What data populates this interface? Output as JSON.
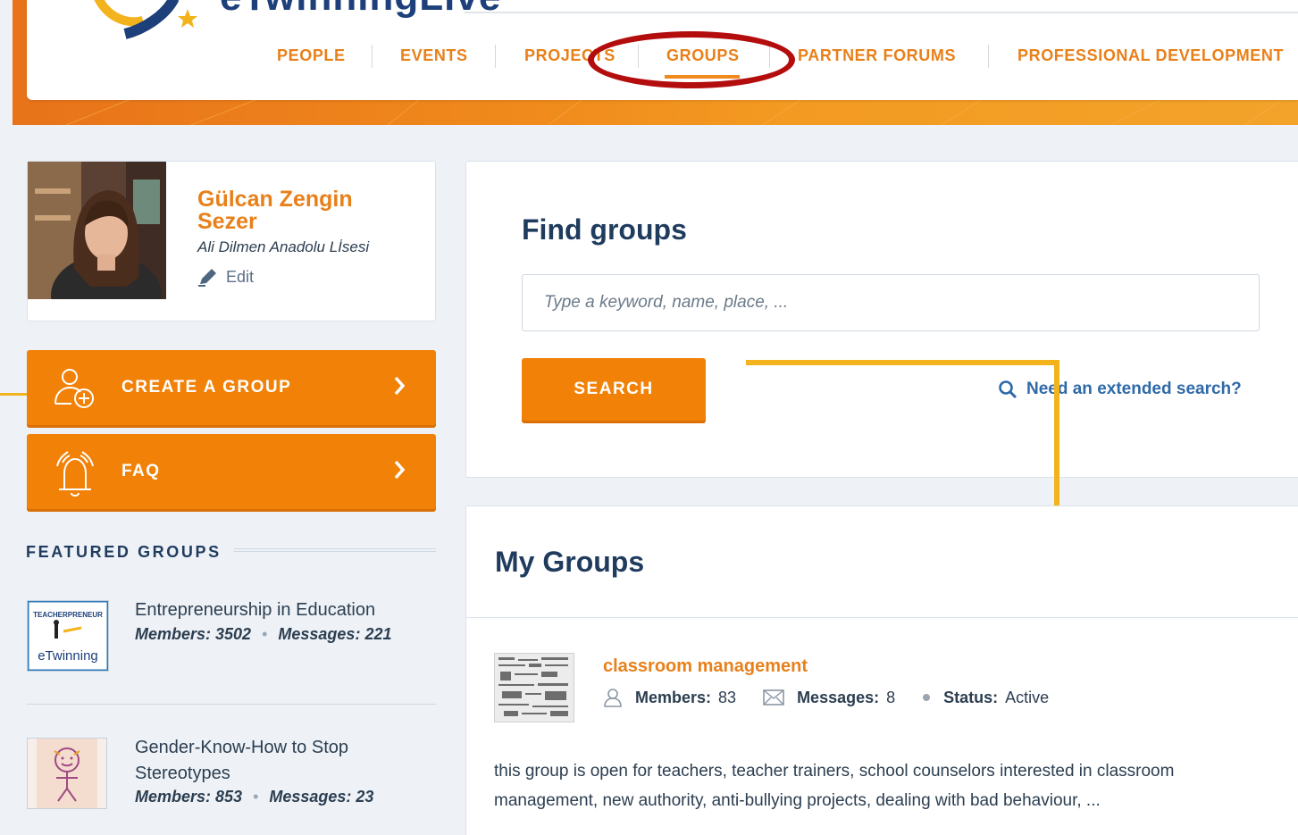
{
  "header": {
    "logo_text": "eTwinningLive",
    "nav": [
      {
        "label": "PEOPLE"
      },
      {
        "label": "EVENTS"
      },
      {
        "label": "PROJECTS"
      },
      {
        "label": "GROUPS"
      },
      {
        "label": "PARTNER FORUMS"
      },
      {
        "label": "PROFESSIONAL DEVELOPMENT"
      }
    ],
    "active_tab": "GROUPS"
  },
  "profile": {
    "name": "Gülcan Zengin Sezer",
    "school": "Ali Dilmen Anadolu Lİsesi",
    "edit_label": "Edit"
  },
  "actions": {
    "create_group": "CREATE A GROUP",
    "faq": "FAQ"
  },
  "featured": {
    "title": "FEATURED GROUPS",
    "items": [
      {
        "name": "Entrepreneurship in Education",
        "members": "Members: 3502",
        "messages": "Messages: 221",
        "thumb_text_top": "TEACHERPRENEUR",
        "thumb_text_bottom": "eTwinning"
      },
      {
        "name": "Gender-Know-How to Stop Stereotypes",
        "members": "Members: 853",
        "messages": "Messages: 23"
      }
    ]
  },
  "find": {
    "title": "Find groups",
    "placeholder": "Type a keyword, name, place, ...",
    "search_label": "SEARCH",
    "extended_label": "Need an extended search?"
  },
  "my_groups": {
    "title": "My Groups",
    "items": [
      {
        "name": "classroom management",
        "members_label": "Members:",
        "members_value": "83",
        "messages_label": "Messages:",
        "messages_value": "8",
        "status_label": "Status:",
        "status_value": "Active",
        "description": "this group is open for teachers, teacher trainers, school counselors interested in classroom management, new authority, anti-bullying projects, dealing with bad behaviour, ..."
      }
    ]
  },
  "colors": {
    "accent": "#f28108",
    "nav_text": "#e8801a",
    "heading": "#1f3b5e",
    "link": "#2f6aa8",
    "annotation_red": "#b30d0d",
    "annotation_yellow": "#f3b31d"
  }
}
